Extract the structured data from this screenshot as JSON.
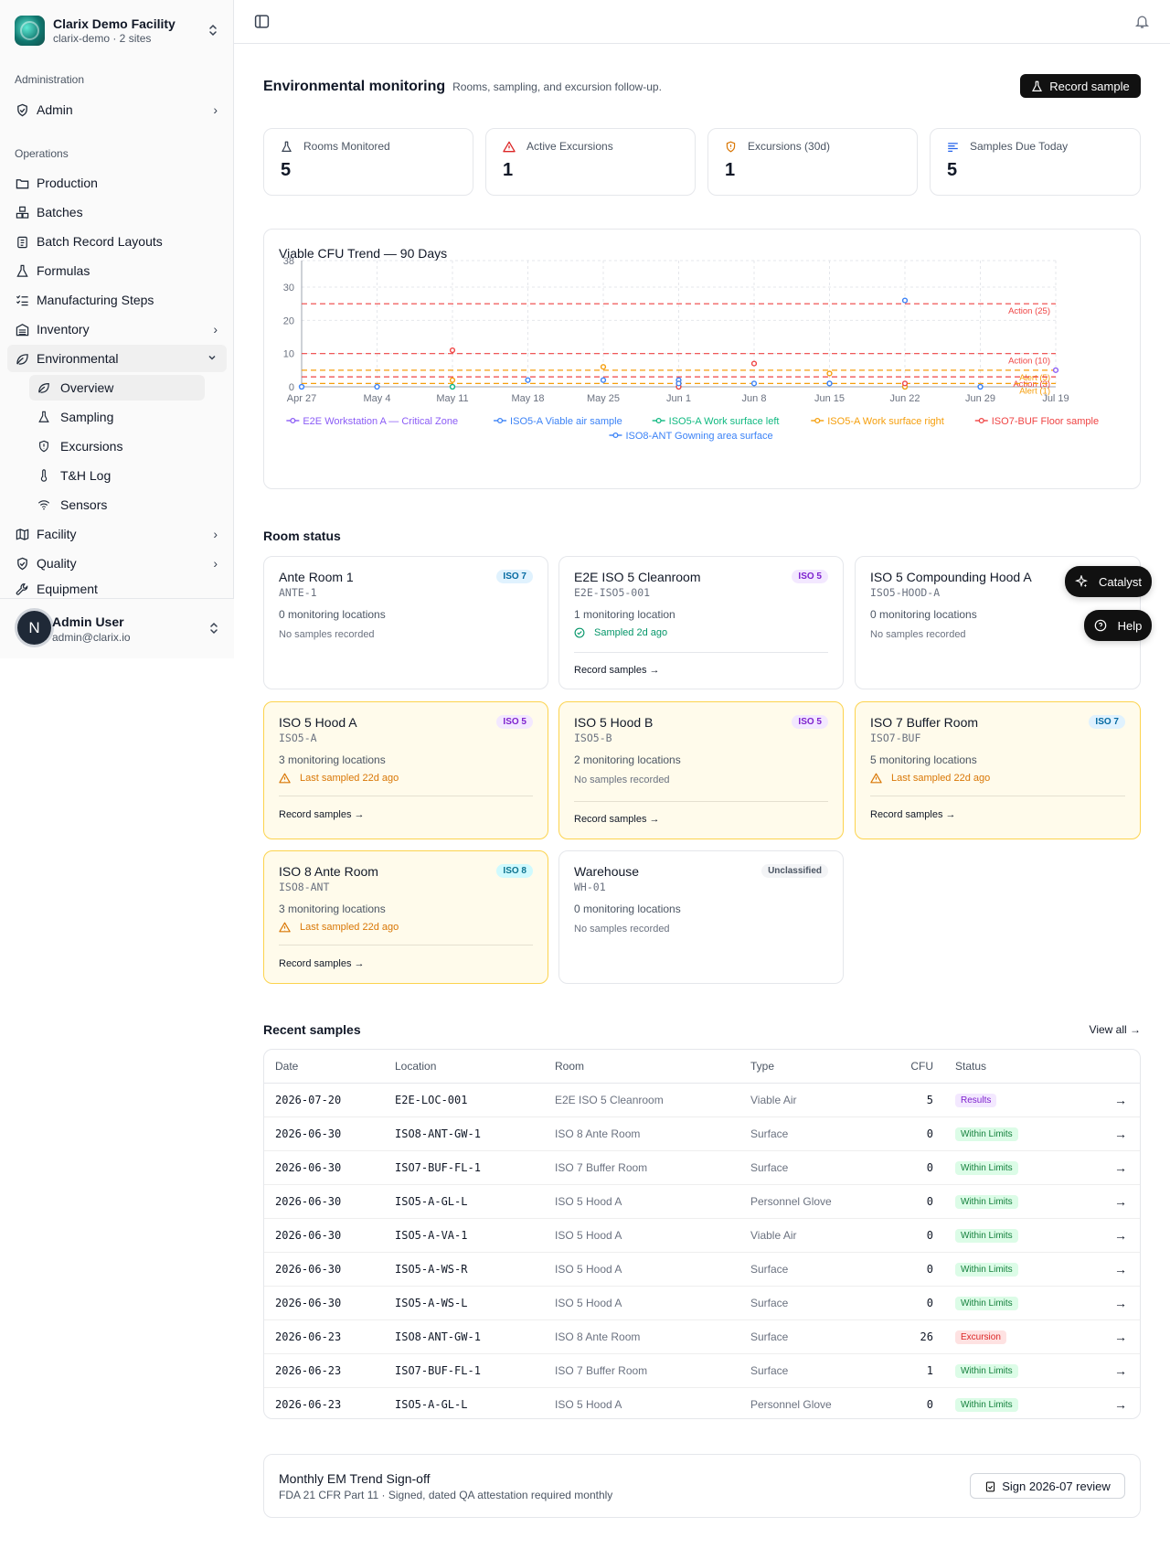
{
  "org": {
    "name": "Clarix Demo Facility",
    "subtitle": "clarix-demo · 2 sites"
  },
  "sidebar": {
    "admin_label": "Administration",
    "ops_label": "Operations",
    "items": [
      {
        "label": "Admin",
        "icon": "shield-check-icon"
      },
      {
        "label": "Production",
        "icon": "folder-icon"
      },
      {
        "label": "Batches",
        "icon": "boxes-icon"
      },
      {
        "label": "Batch Record Layouts",
        "icon": "clipboard-icon"
      },
      {
        "label": "Formulas",
        "icon": "flask-icon"
      },
      {
        "label": "Manufacturing Steps",
        "icon": "list-checks-icon"
      },
      {
        "label": "Inventory",
        "icon": "warehouse-icon"
      },
      {
        "label": "Environmental",
        "icon": "leaf-icon"
      },
      {
        "label": "Facility",
        "icon": "map-icon"
      },
      {
        "label": "Quality",
        "icon": "shield-check-icon"
      },
      {
        "label": "Equipment",
        "icon": "wrench-icon"
      }
    ],
    "env_sub": [
      {
        "label": "Overview",
        "icon": "leaf-icon"
      },
      {
        "label": "Sampling",
        "icon": "flask-icon"
      },
      {
        "label": "Excursions",
        "icon": "shield-alert-icon"
      },
      {
        "label": "T&H Log",
        "icon": "thermometer-icon"
      },
      {
        "label": "Sensors",
        "icon": "wifi-icon"
      }
    ]
  },
  "user": {
    "initial": "N",
    "name": "Admin User",
    "email": "admin@clarix.io"
  },
  "page": {
    "title": "Environmental monitoring",
    "subtitle": "Rooms, sampling, and excursion follow-up.",
    "record_btn": "Record sample"
  },
  "stats": [
    {
      "label": "Rooms Monitored",
      "value": "5",
      "icon": "flask-icon",
      "color": "#374151"
    },
    {
      "label": "Active Excursions",
      "value": "1",
      "icon": "alert-triangle-icon",
      "color": "#dc2626"
    },
    {
      "label": "Excursions (30d)",
      "value": "1",
      "icon": "shield-alert-icon",
      "color": "#d97706"
    },
    {
      "label": "Samples Due Today",
      "value": "5",
      "icon": "list-icon",
      "color": "#2563eb"
    }
  ],
  "chart_data": {
    "type": "line",
    "title": "Viable CFU Trend — 90 Days",
    "x": [
      "Apr 27",
      "May 4",
      "May 11",
      "May 18",
      "May 25",
      "Jun 1",
      "Jun 8",
      "Jun 15",
      "Jun 22",
      "Jun 29",
      "Jul 19"
    ],
    "ylim": [
      0,
      38
    ],
    "yticks": [
      0,
      10,
      20,
      30,
      38
    ],
    "grid": true,
    "legend_position": "bottom",
    "series": [
      {
        "name": "E2E Workstation A — Critical Zone",
        "color": "#8b5cf6",
        "points": [
          [
            "Jul 19",
            5
          ]
        ]
      },
      {
        "name": "ISO5-A Viable air sample",
        "color": "#3b82f6",
        "points": [
          [
            "Apr 27",
            0
          ],
          [
            "May 4",
            0
          ],
          [
            "May 11",
            0
          ],
          [
            "May 18",
            2
          ],
          [
            "May 25",
            2
          ],
          [
            "Jun 1",
            2
          ],
          [
            "Jun 8",
            1
          ],
          [
            "Jun 15",
            1
          ],
          [
            "Jun 22",
            26
          ],
          [
            "Jun 29",
            0
          ]
        ]
      },
      {
        "name": "ISO5-A Work surface left",
        "color": "#10b981",
        "points": [
          [
            "May 11",
            0
          ],
          [
            "Jun 1",
            0
          ],
          [
            "Jun 22",
            0
          ]
        ]
      },
      {
        "name": "ISO5-A Work surface right",
        "color": "#f59e0b",
        "points": [
          [
            "May 11",
            2
          ],
          [
            "May 25",
            6
          ],
          [
            "Jun 1",
            1
          ],
          [
            "Jun 15",
            4
          ],
          [
            "Jun 22",
            0
          ]
        ]
      },
      {
        "name": "ISO7-BUF Floor sample",
        "color": "#ef4444",
        "points": [
          [
            "May 11",
            11
          ],
          [
            "Jun 1",
            0
          ],
          [
            "Jun 8",
            7
          ],
          [
            "Jun 22",
            1
          ]
        ]
      },
      {
        "name": "ISO8-ANT Gowning area surface",
        "color": "#3b82f6",
        "points": [
          [
            "Apr 27",
            0
          ],
          [
            "Jun 1",
            1
          ],
          [
            "Jun 15",
            1
          ],
          [
            "Jun 29",
            0
          ]
        ]
      }
    ],
    "thresholds": [
      {
        "label": "Action (25)",
        "value": 25,
        "color": "#ef4444"
      },
      {
        "label": "Action (10)",
        "value": 10,
        "color": "#ef4444"
      },
      {
        "label": "Alert (5)",
        "value": 5,
        "color": "#f59e0b"
      },
      {
        "label": "Action (3)",
        "value": 3,
        "color": "#ef4444"
      },
      {
        "label": "Alert (1)",
        "value": 1,
        "color": "#f59e0b"
      }
    ]
  },
  "room_section": "Room status",
  "rooms": [
    {
      "name": "Ante Room 1",
      "code": "ANTE-1",
      "badge": "ISO 7",
      "locations": "0 monitoring locations",
      "status": "No samples recorded",
      "link": ""
    },
    {
      "name": "E2E ISO 5 Cleanroom",
      "code": "E2E-ISO5-001",
      "badge": "ISO 5",
      "locations": "1 monitoring location",
      "status": "Sampled 2d ago",
      "link": "Record samples →"
    },
    {
      "name": "ISO 5 Compounding Hood A",
      "code": "ISO5-HOOD-A",
      "badge": "",
      "locations": "0 monitoring locations",
      "status": "No samples recorded",
      "link": ""
    },
    {
      "name": "ISO 5 Hood A",
      "code": "ISO5-A",
      "badge": "ISO 5",
      "locations": "3 monitoring locations",
      "status": "Last sampled 22d ago",
      "link": "Record samples →"
    },
    {
      "name": "ISO 5 Hood B",
      "code": "ISO5-B",
      "badge": "ISO 5",
      "locations": "2 monitoring locations",
      "status": "No samples recorded",
      "link": "Record samples →"
    },
    {
      "name": "ISO 7 Buffer Room",
      "code": "ISO7-BUF",
      "badge": "ISO 7",
      "locations": "5 monitoring locations",
      "status": "Last sampled 22d ago",
      "link": "Record samples →"
    },
    {
      "name": "ISO 8 Ante Room",
      "code": "ISO8-ANT",
      "badge": "ISO 8",
      "locations": "3 monitoring locations",
      "status": "Last sampled 22d ago",
      "link": "Record samples →"
    },
    {
      "name": "Warehouse",
      "code": "WH-01",
      "badge": "Unclassified",
      "locations": "0 monitoring locations",
      "status": "No samples recorded",
      "link": ""
    }
  ],
  "recent": {
    "title": "Recent samples",
    "view_all": "View all →",
    "columns": [
      "Date",
      "Location",
      "Room",
      "Type",
      "CFU",
      "Status"
    ],
    "rows": [
      [
        "2026-07-20",
        "E2E-LOC-001",
        "E2E ISO 5 Cleanroom",
        "Viable Air",
        "5",
        "Results"
      ],
      [
        "2026-06-30",
        "ISO8-ANT-GW-1",
        "ISO 8 Ante Room",
        "Surface",
        "0",
        "Within Limits"
      ],
      [
        "2026-06-30",
        "ISO7-BUF-FL-1",
        "ISO 7 Buffer Room",
        "Surface",
        "0",
        "Within Limits"
      ],
      [
        "2026-06-30",
        "ISO5-A-GL-L",
        "ISO 5 Hood A",
        "Personnel Glove",
        "0",
        "Within Limits"
      ],
      [
        "2026-06-30",
        "ISO5-A-VA-1",
        "ISO 5 Hood A",
        "Viable Air",
        "0",
        "Within Limits"
      ],
      [
        "2026-06-30",
        "ISO5-A-WS-R",
        "ISO 5 Hood A",
        "Surface",
        "0",
        "Within Limits"
      ],
      [
        "2026-06-30",
        "ISO5-A-WS-L",
        "ISO 5 Hood A",
        "Surface",
        "0",
        "Within Limits"
      ],
      [
        "2026-06-23",
        "ISO8-ANT-GW-1",
        "ISO 8 Ante Room",
        "Surface",
        "26",
        "Excursion"
      ],
      [
        "2026-06-23",
        "ISO7-BUF-FL-1",
        "ISO 7 Buffer Room",
        "Surface",
        "1",
        "Within Limits"
      ],
      [
        "2026-06-23",
        "ISO5-A-GL-L",
        "ISO 5 Hood A",
        "Personnel Glove",
        "0",
        "Within Limits"
      ]
    ]
  },
  "signoff": {
    "title": "Monthly EM Trend Sign-off",
    "subtitle": "FDA 21 CFR Part 11 · Signed, dated QA attestation required monthly",
    "button": "Sign 2026-07 review"
  },
  "floating": {
    "catalyst": "Catalyst",
    "help": "Help"
  }
}
